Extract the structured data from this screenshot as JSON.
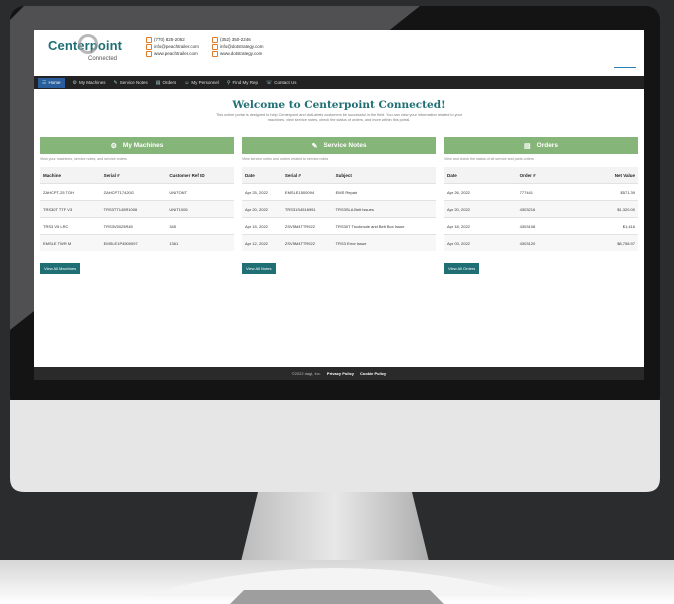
{
  "header": {
    "brand": "Centerpoint",
    "brand_sub": "Connected",
    "contact_left": [
      "(770) 825-2062",
      "info@peachtrailer.com",
      "www.peachtrailer.com"
    ],
    "contact_right": [
      "(352) 350-2246",
      "info@dotstrategy.com",
      "www.dotstrategy.com"
    ]
  },
  "nav": [
    {
      "label": "Home",
      "icon": "home-icon",
      "glyph": "☰"
    },
    {
      "label": "My Machines",
      "icon": "machines-icon",
      "glyph": "⚙"
    },
    {
      "label": "Service Notes",
      "icon": "service-icon",
      "glyph": "✎"
    },
    {
      "label": "Orders",
      "icon": "orders-icon",
      "glyph": "▤"
    },
    {
      "label": "My Personnel",
      "icon": "personnel-icon",
      "glyph": "☺"
    },
    {
      "label": "Find My Rep",
      "icon": "rep-icon",
      "glyph": "⚲"
    },
    {
      "label": "Contact Us",
      "icon": "contact-icon",
      "glyph": "☏"
    }
  ],
  "welcome": {
    "title": "Welcome to Centerpoint Connected!",
    "text": "This online portal is designed to help Centerpoint and dotLabels customers be successful in the field. You can view your information related to your machines, view service notes, check the status of orders, and more within this portal."
  },
  "machines": {
    "title": "My Machines",
    "icon": "machine-icon",
    "glyph": "⚙",
    "desc": "View your machines, service notes, and service orders",
    "headers": [
      "Machine",
      "Serial #",
      "Customer Ref ID"
    ],
    "rows": [
      [
        "ZAHCPT-25 TOH",
        "ZAHCPT17420G",
        "UNITONT"
      ],
      [
        "TRS30T TTF V3",
        "TRS3TT145R1006",
        "UNIT1006"
      ],
      [
        "TRS3 V5 LRC",
        "TRS3V5025R45",
        "345"
      ],
      [
        "EMSLE TWR M",
        "EMSLE1P4500097",
        "1361"
      ]
    ],
    "button": "View All Machines"
  },
  "service": {
    "title": "Service Notes",
    "icon": "wrench-icon",
    "glyph": "✎",
    "desc": "View service notes and orders related to service notes",
    "headers": [
      "Date",
      "Serial #",
      "Subject"
    ],
    "rows": [
      [
        "Apr 25, 2022",
        "EMSLE1500094",
        "EMS Repair"
      ],
      [
        "Apr 20, 2022",
        "TRS31S4516991",
        "TRS3SLA Belt Issues"
      ],
      [
        "Apr 15, 2022",
        "ZSV5M4TTR922",
        "TRS30T Truckmule and Belt Box Issue"
      ],
      [
        "Apr 12, 2022",
        "ZSV5M4TTR922",
        "TRS3 Error Issue"
      ]
    ],
    "button": "View All Notes"
  },
  "orders": {
    "title": "Orders",
    "icon": "orders-icon",
    "glyph": "▤",
    "desc": "View and check the status of all service and parts orders",
    "headers": [
      "Date",
      "Order #",
      "Net Value"
    ],
    "rows": [
      [
        "Apr 26, 2022",
        "777441",
        "$571.39"
      ],
      [
        "Apr 20, 2022",
        "4303216",
        "$1,320.00"
      ],
      [
        "Apr 18, 2022",
        "4303108",
        "$1,416"
      ],
      [
        "Apr 03, 2022",
        "4303120",
        "$8,758.97"
      ]
    ],
    "button": "View All Orders"
  },
  "footer": {
    "copyright": "©2022 dagi, Inc.",
    "privacy": "Privacy Policy",
    "cookie": "Cookie Policy"
  }
}
